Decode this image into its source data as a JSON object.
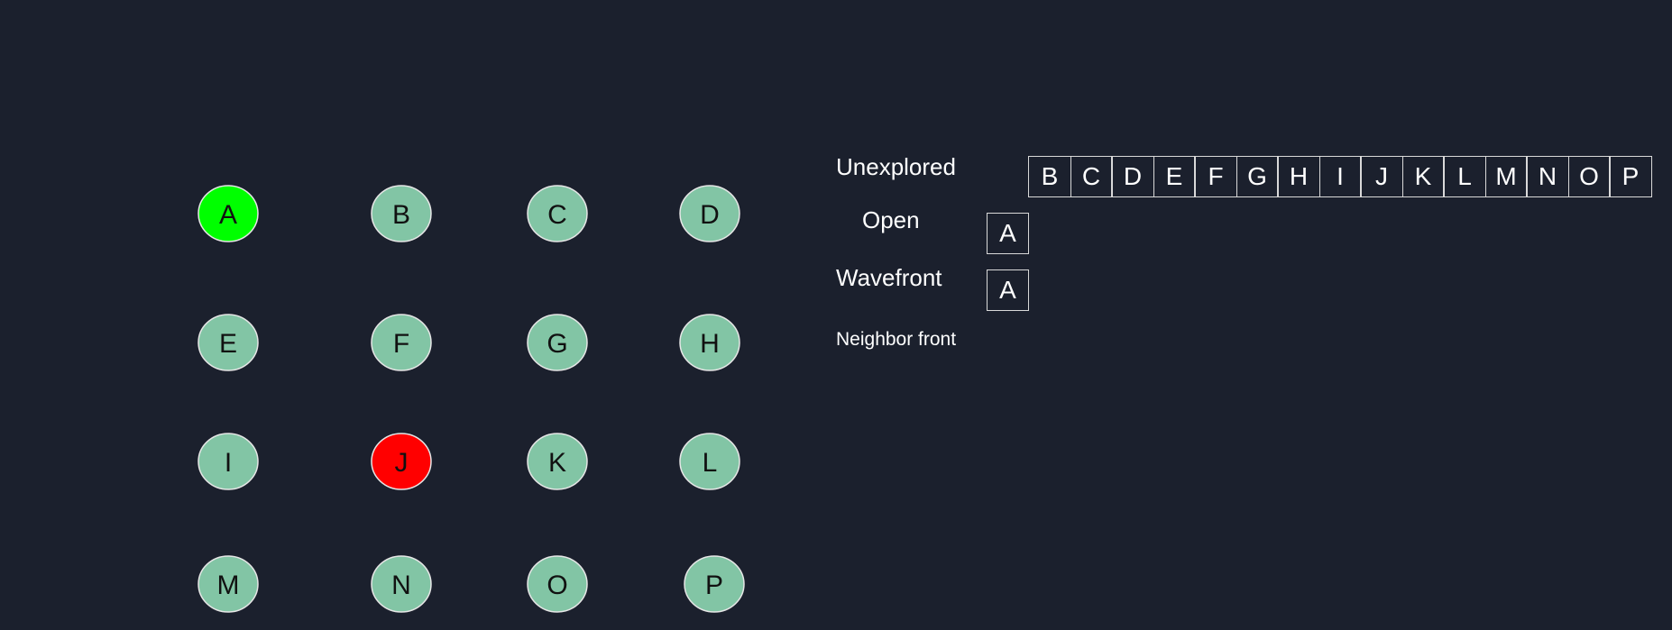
{
  "colors": {
    "background": "#1b202d",
    "node_default": "#82c5a5",
    "node_start": "#00ff00",
    "node_goal": "#ff0000",
    "node_stroke": "#e6e6e6",
    "text": "#ffffff",
    "cell_border": "#d9d9d9"
  },
  "nodes": [
    {
      "id": "A",
      "state": "start"
    },
    {
      "id": "B",
      "state": "default"
    },
    {
      "id": "C",
      "state": "default"
    },
    {
      "id": "D",
      "state": "default"
    },
    {
      "id": "E",
      "state": "default"
    },
    {
      "id": "F",
      "state": "default"
    },
    {
      "id": "G",
      "state": "default"
    },
    {
      "id": "H",
      "state": "default"
    },
    {
      "id": "I",
      "state": "default"
    },
    {
      "id": "J",
      "state": "goal"
    },
    {
      "id": "K",
      "state": "default"
    },
    {
      "id": "L",
      "state": "default"
    },
    {
      "id": "M",
      "state": "default"
    },
    {
      "id": "N",
      "state": "default"
    },
    {
      "id": "O",
      "state": "default"
    },
    {
      "id": "P",
      "state": "default"
    }
  ],
  "panel": {
    "unexplored_label": "Unexplored",
    "open_label": "Open",
    "wavefront_label": "Wavefront",
    "neighbor_label": "Neighbor front",
    "unexplored": [
      "B",
      "C",
      "D",
      "E",
      "F",
      "G",
      "H",
      "I",
      "J",
      "K",
      "L",
      "M",
      "N",
      "O",
      "P"
    ],
    "open": [
      "A"
    ],
    "wavefront": [
      "A"
    ],
    "neighbor_front": []
  }
}
